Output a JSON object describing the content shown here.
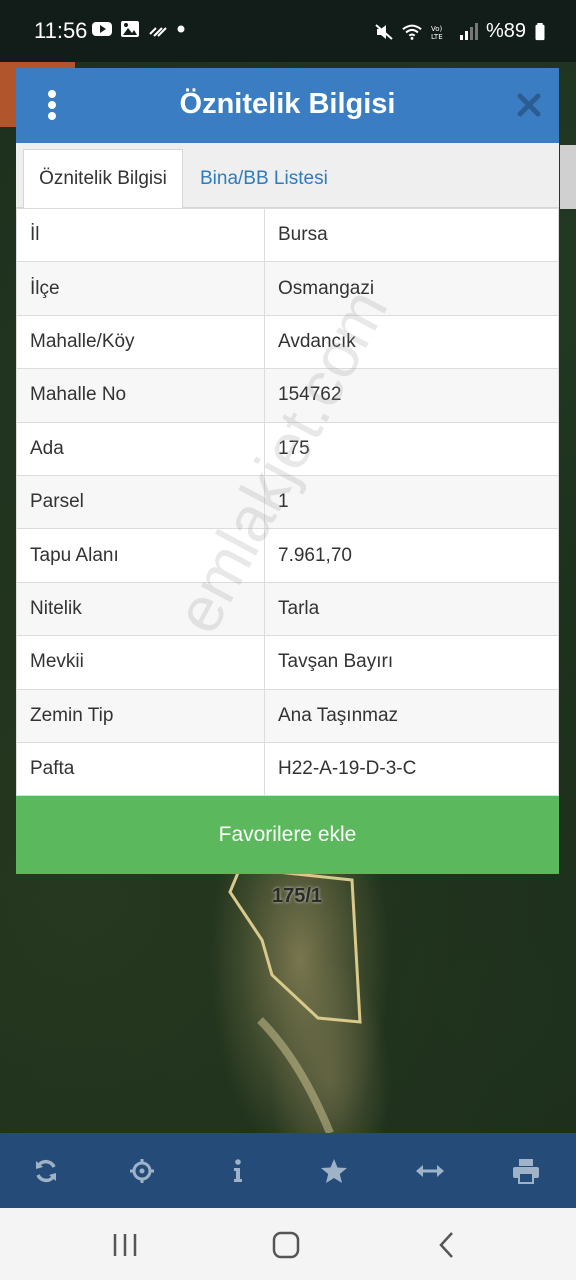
{
  "status_bar": {
    "time": "11:56",
    "battery": "%89",
    "icons_left": [
      "youtube-icon",
      "gallery-icon",
      "data-icon",
      "dot-icon"
    ],
    "icons_right": [
      "mute-icon",
      "wifi-icon",
      "volte-icon",
      "signal-icon",
      "battery-icon"
    ]
  },
  "map": {
    "parcel_label": "175/1"
  },
  "dialog": {
    "title": "Öznitelik Bilgisi",
    "tabs": [
      {
        "label": "Öznitelik Bilgisi",
        "active": true
      },
      {
        "label": "Bina/BB Listesi",
        "active": false
      }
    ],
    "rows": [
      {
        "key": "İl",
        "value": "Bursa"
      },
      {
        "key": "İlçe",
        "value": "Osmangazi"
      },
      {
        "key": "Mahalle/Köy",
        "value": "Avdancık"
      },
      {
        "key": "Mahalle No",
        "value": "154762"
      },
      {
        "key": "Ada",
        "value": "175"
      },
      {
        "key": "Parsel",
        "value": "1"
      },
      {
        "key": "Tapu Alanı",
        "value": "7.961,70"
      },
      {
        "key": "Nitelik",
        "value": "Tarla"
      },
      {
        "key": "Mevkii",
        "value": "Tavşan Bayırı"
      },
      {
        "key": "Zemin Tip",
        "value": "Ana Taşınmaz"
      },
      {
        "key": "Pafta",
        "value": "H22-A-19-D-3-C"
      }
    ],
    "favorite_button": "Favorilere ekle"
  },
  "watermark": "emlakjet.com",
  "toolbar": {
    "tools": [
      "refresh-icon",
      "locate-icon",
      "info-icon",
      "star-icon",
      "measure-icon",
      "print-icon"
    ]
  },
  "navbar": {
    "buttons": [
      "recent-apps-icon",
      "home-icon",
      "back-icon"
    ]
  },
  "colors": {
    "header": "#3a7dc2",
    "tab_link": "#2f7bbd",
    "favorite": "#5cb85c",
    "toolbar": "#254c78"
  }
}
